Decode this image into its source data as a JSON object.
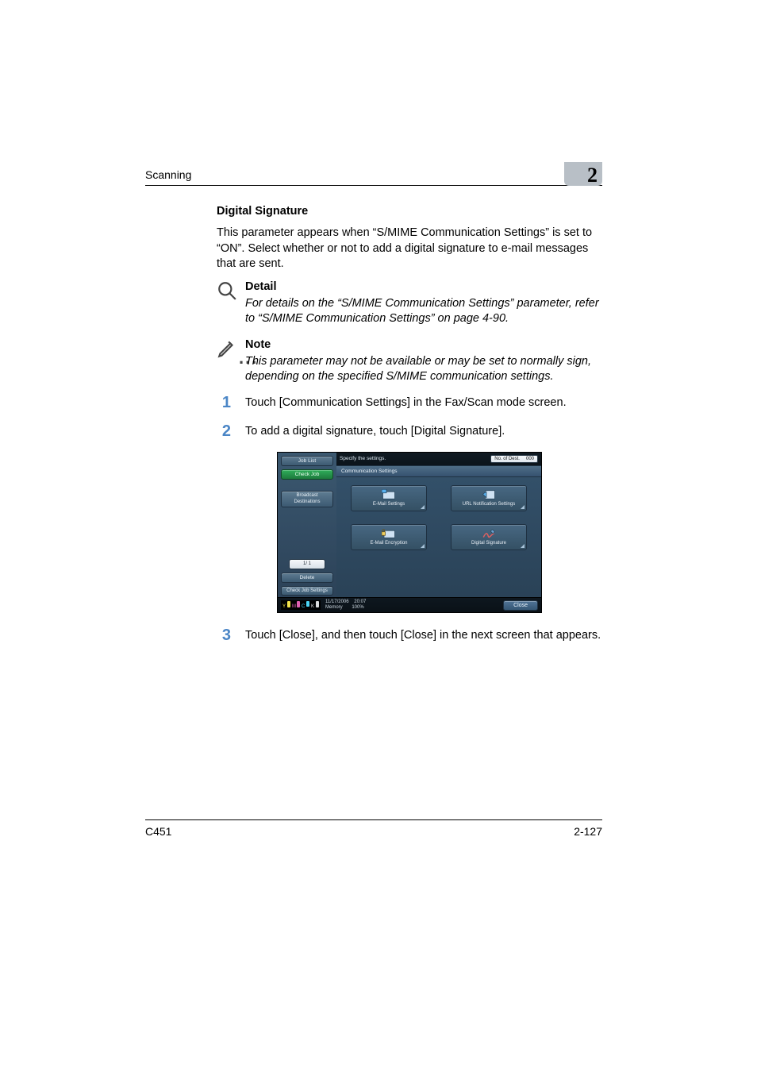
{
  "header": {
    "running_title": "Scanning",
    "chapter_number": "2"
  },
  "section": {
    "heading": "Digital Signature",
    "intro": "This parameter appears when “S/MIME Communication Settings” is set to “ON”. Select whether or not to add a digital signature to e-mail messages that are sent."
  },
  "detail": {
    "title": "Detail",
    "text": "For details on the “S/MIME Communication Settings” parameter, refer to “S/MIME Communication Settings” on page 4-90."
  },
  "note": {
    "ellipsis": "...",
    "title": "Note",
    "text": "This parameter may not be available or may be set to normally sign, depending on the specified S/MIME communication settings."
  },
  "steps": {
    "s1_num": "1",
    "s1_text": "Touch [Communication Settings] in the Fax/Scan mode screen.",
    "s2_num": "2",
    "s2_text": "To add a digital signature, touch [Digital Signature].",
    "s3_num": "3",
    "s3_text": "Touch [Close], and then touch [Close] in the next screen that appears."
  },
  "printer_ui": {
    "left": {
      "job_list": "Job List",
      "check_job": "Check Job",
      "broadcast": "Broadcast Destinations",
      "pager": "1/   1",
      "delete": "Delete",
      "check_job_settings": "Check Job Settings"
    },
    "status": {
      "prompt": "Specify the settings.",
      "dest_label": "No. of Dest.",
      "dest_count": "000"
    },
    "section_bar": "Communication Settings",
    "tiles": {
      "email_settings": "E-Mail Settings",
      "url_notif": "URL Notification Settings",
      "email_encrypt": "E-Mail Encryption",
      "digital_sig": "Digital Signature"
    },
    "bottom": {
      "date": "11/17/2006",
      "time": "20:07",
      "memory_label": "Memory",
      "memory_value": "100%",
      "close": "Close"
    },
    "toner": {
      "y_label": "Y",
      "m_label": "M",
      "c_label": "C",
      "k_label": "K"
    }
  },
  "footer": {
    "model": "C451",
    "page": "2-127"
  }
}
